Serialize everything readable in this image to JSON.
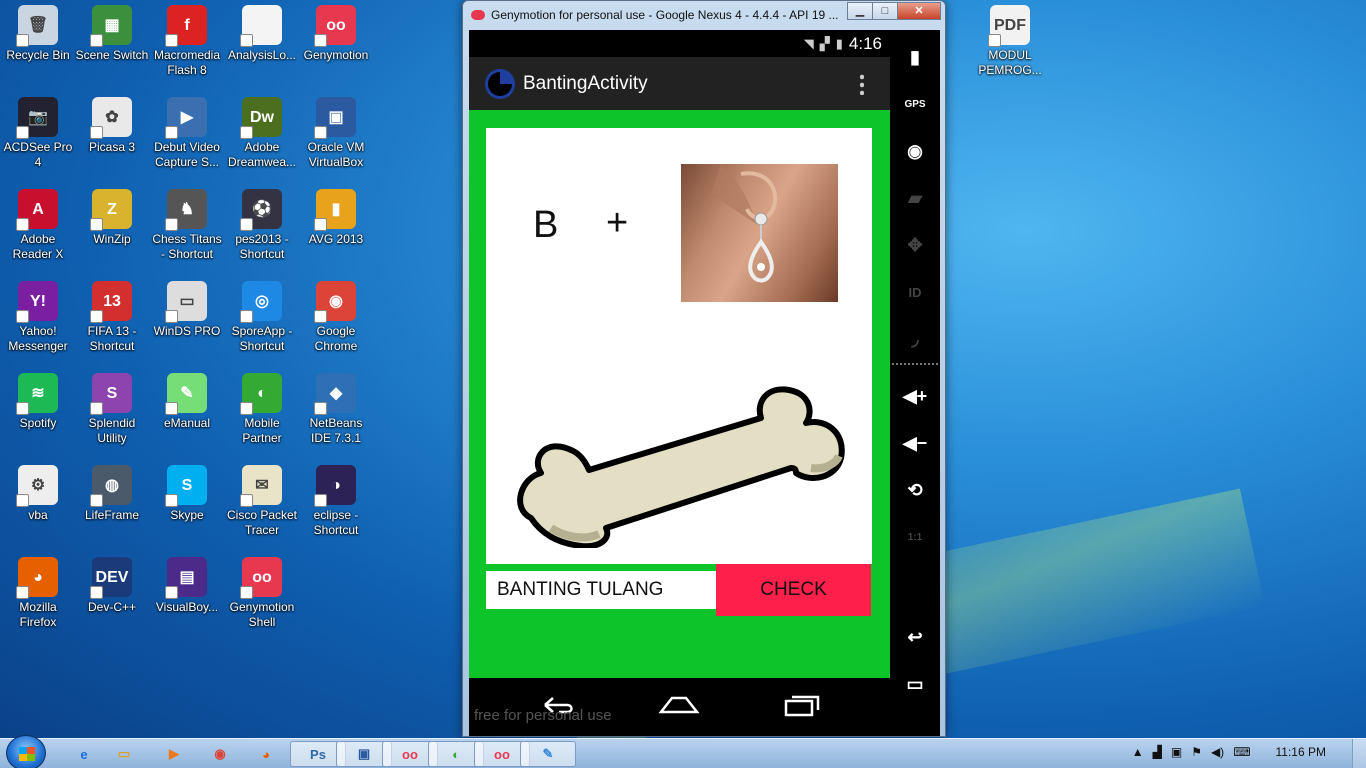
{
  "desktop": {
    "icons": [
      {
        "label": "Recycle Bin",
        "icon": "recycle-bin-icon",
        "color": "#c9d6e2",
        "glyph": "🗑"
      },
      {
        "label": "Scene Switch",
        "icon": "scene-switch-icon",
        "color": "#3c8f3c",
        "glyph": "▦"
      },
      {
        "label": "Macromedia Flash 8",
        "icon": "flash-icon",
        "color": "#d22",
        "glyph": "f"
      },
      {
        "label": "AnalysisLo...",
        "icon": "file-icon",
        "color": "#f4f4f4",
        "glyph": ""
      },
      {
        "label": "Genymotion",
        "icon": "genymotion-icon",
        "color": "#e8384f",
        "glyph": "oo"
      },
      {
        "label": "ACDSee Pro 4",
        "icon": "acdsee-icon",
        "color": "#223",
        "glyph": "📷"
      },
      {
        "label": "Picasa 3",
        "icon": "picasa-icon",
        "color": "#e9e9e9",
        "glyph": "✿"
      },
      {
        "label": "Debut Video Capture S...",
        "icon": "debut-icon",
        "color": "#3a6fb0",
        "glyph": "▶"
      },
      {
        "label": "Adobe Dreamwea...",
        "icon": "dreamweaver-icon",
        "color": "#4b6e1f",
        "glyph": "Dw"
      },
      {
        "label": "Oracle VM VirtualBox",
        "icon": "virtualbox-icon",
        "color": "#2c5aa0",
        "glyph": "▣"
      },
      {
        "label": "Adobe Reader X",
        "icon": "adobe-reader-icon",
        "color": "#c8102e",
        "glyph": "A"
      },
      {
        "label": "WinZip",
        "icon": "winzip-icon",
        "color": "#d9b22e",
        "glyph": "Z"
      },
      {
        "label": "Chess Titans - Shortcut",
        "icon": "chess-icon",
        "color": "#555",
        "glyph": "♞"
      },
      {
        "label": "pes2013 - Shortcut",
        "icon": "pes-icon",
        "color": "#334",
        "glyph": "⚽"
      },
      {
        "label": "AVG 2013",
        "icon": "avg-icon",
        "color": "#e8a21c",
        "glyph": "▮"
      },
      {
        "label": "Yahoo! Messenger",
        "icon": "yahoo-icon",
        "color": "#7b1fa2",
        "glyph": "Y!"
      },
      {
        "label": "FIFA 13 - Shortcut",
        "icon": "fifa-icon",
        "color": "#d32f2f",
        "glyph": "13"
      },
      {
        "label": "WinDS PRO",
        "icon": "winds-icon",
        "color": "#ddd",
        "glyph": "▭"
      },
      {
        "label": "SporeApp - Shortcut",
        "icon": "spore-icon",
        "color": "#1e88e5",
        "glyph": "◎"
      },
      {
        "label": "Google Chrome",
        "icon": "chrome-icon",
        "color": "#db4437",
        "glyph": "◉"
      },
      {
        "label": "Spotify",
        "icon": "spotify-icon",
        "color": "#1db954",
        "glyph": "≋"
      },
      {
        "label": "Splendid Utility",
        "icon": "splendid-icon",
        "color": "#8e44ad",
        "glyph": "S"
      },
      {
        "label": "eManual",
        "icon": "emanual-icon",
        "color": "#7d7",
        "glyph": "✎"
      },
      {
        "label": "Mobile Partner",
        "icon": "mobile-partner-icon",
        "color": "#3a3",
        "glyph": "◐"
      },
      {
        "label": "NetBeans IDE 7.3.1",
        "icon": "netbeans-icon",
        "color": "#2f6fb5",
        "glyph": "◆"
      },
      {
        "label": "vba",
        "icon": "vba-file-icon",
        "color": "#eee",
        "glyph": "⚙"
      },
      {
        "label": "LifeFrame",
        "icon": "lifeframe-icon",
        "color": "#4a5a6a",
        "glyph": "◍"
      },
      {
        "label": "Skype",
        "icon": "skype-icon",
        "color": "#00aff0",
        "glyph": "S"
      },
      {
        "label": "Cisco Packet Tracer",
        "icon": "packet-tracer-icon",
        "color": "#e9e4c8",
        "glyph": "✉"
      },
      {
        "label": "eclipse - Shortcut",
        "icon": "eclipse-icon",
        "color": "#2c2255",
        "glyph": "◑"
      },
      {
        "label": "Mozilla Firefox",
        "icon": "firefox-icon",
        "color": "#e66000",
        "glyph": "◕"
      },
      {
        "label": "Dev-C++",
        "icon": "devcpp-icon",
        "color": "#1a3a7a",
        "glyph": "DEV"
      },
      {
        "label": "VisualBoy...",
        "icon": "visualboy-icon",
        "color": "#4b2a8a",
        "glyph": "▤"
      },
      {
        "label": "Genymotion Shell",
        "icon": "genymotion-shell-icon",
        "color": "#e8384f",
        "glyph": "oo"
      },
      {
        "label": "MODUL PEMROG...",
        "icon": "pdf-file-icon",
        "color": "#f2f2f2",
        "glyph": "PDF"
      }
    ]
  },
  "emulator": {
    "window_title": "Genymotion for personal use - Google Nexus 4 - 4.4.4 - API 19 ...",
    "status_time": "4:16",
    "app_title": "BantingActivity",
    "puzzle_letter": "B",
    "puzzle_operator": "+",
    "answer_value": "BANTING TULANG",
    "check_label": "CHECK",
    "watermark": "free for personal use",
    "colors": {
      "content_bg": "#0dc42a",
      "check_bg": "#ff1f4b"
    },
    "side_labels": {
      "gps": "GPS",
      "id": "ID",
      "ratio": "1:1"
    }
  },
  "taskbar": {
    "clock": "11:16 PM",
    "items": [
      "explorer-ie",
      "file-explorer",
      "media-player",
      "chrome",
      "firefox",
      "photoshop",
      "virtualbox",
      "genymotion",
      "android-tool",
      "genymotion-window",
      "paint"
    ]
  }
}
